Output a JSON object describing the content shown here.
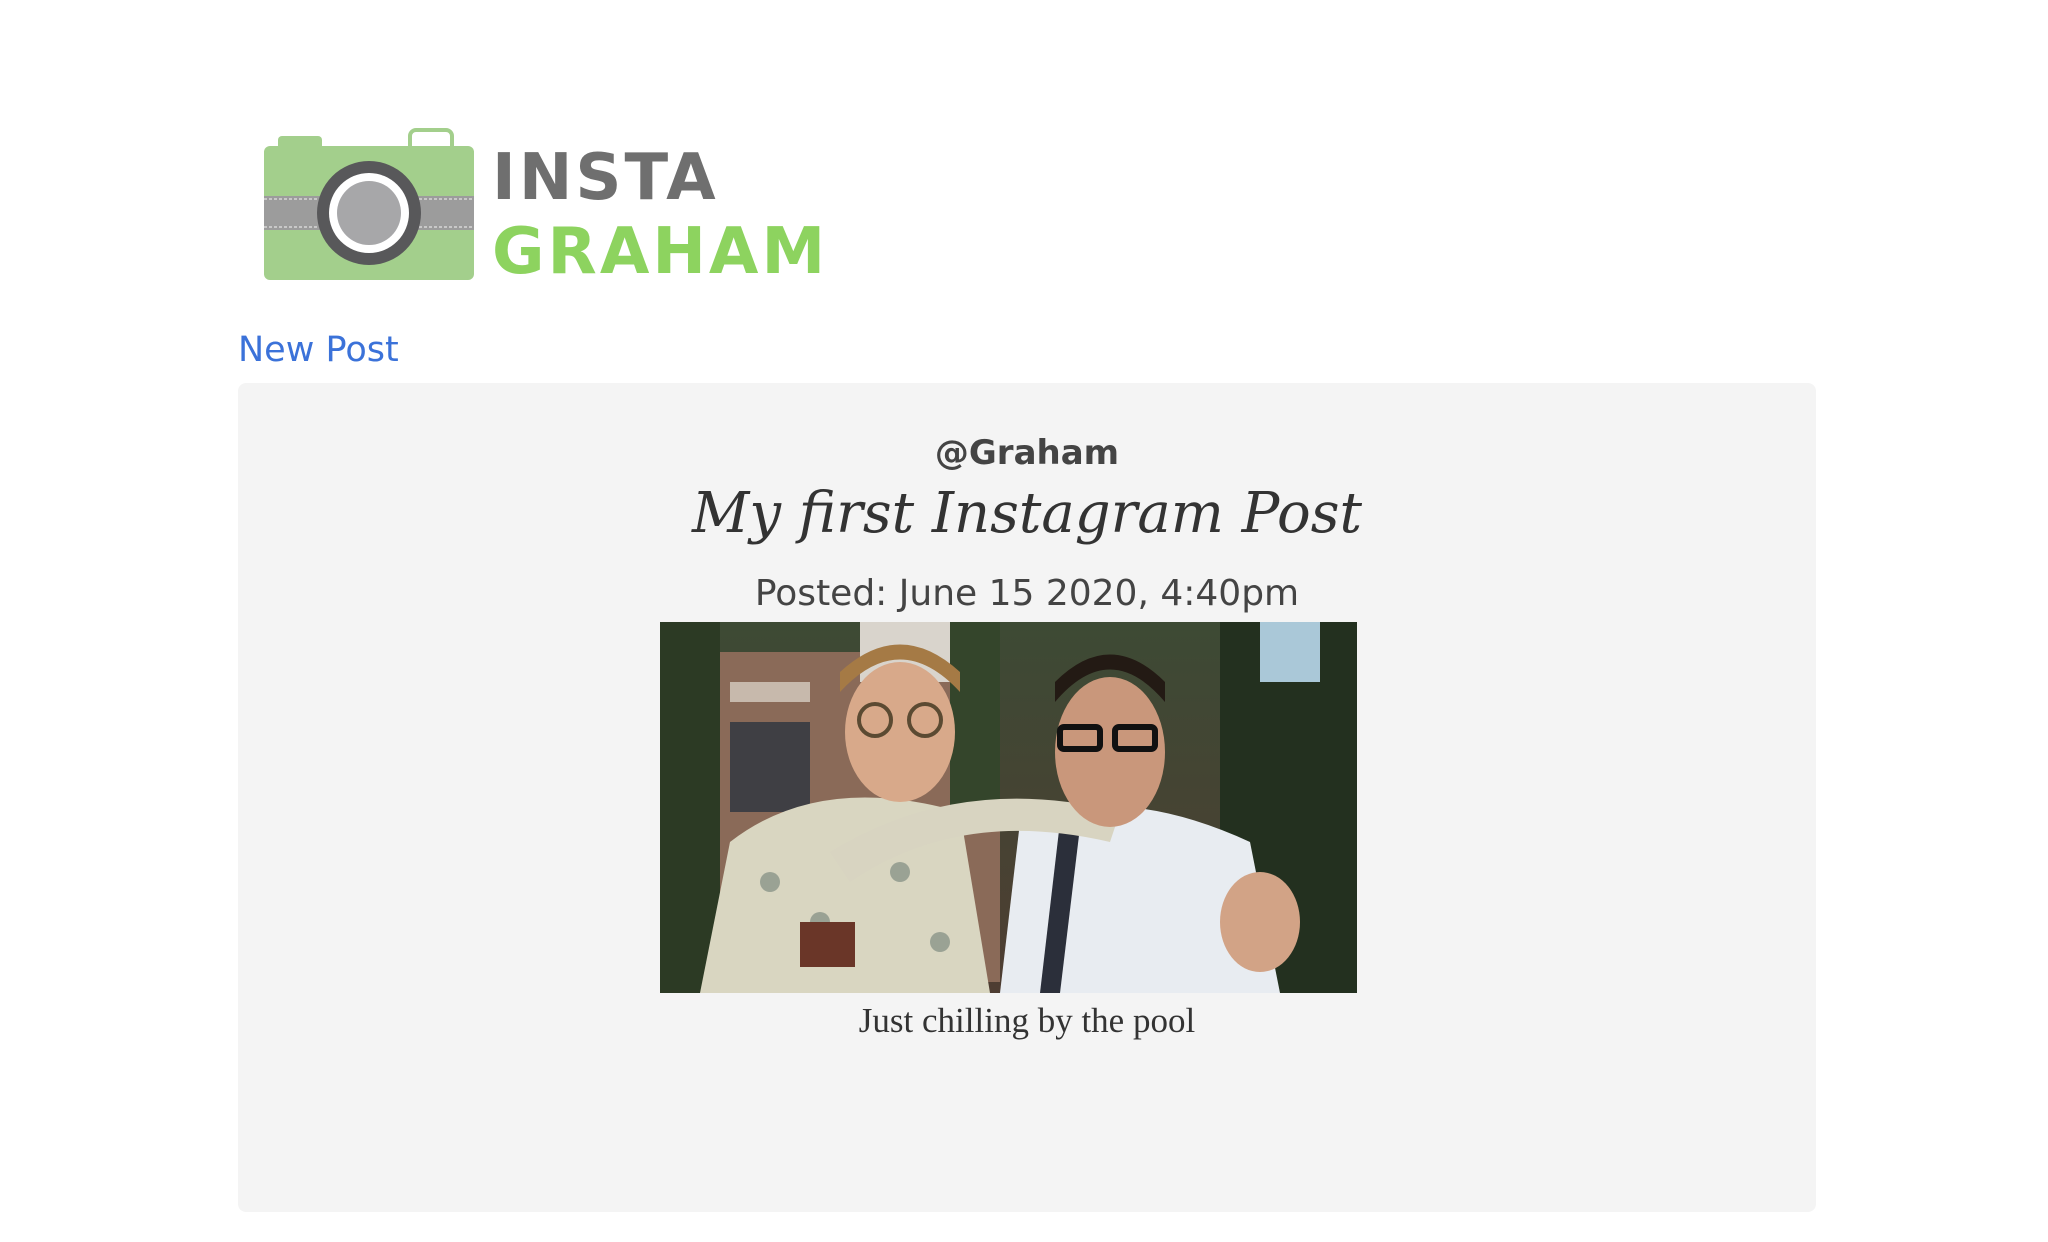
{
  "logo": {
    "word_top": "INSTA",
    "word_bottom": "GRAHAM",
    "icon": "camera-icon",
    "colors": {
      "camera_body": "#a3cf8c",
      "lens_ring": "#58585a",
      "lens_center": "#a7a7a9",
      "strap": "#9c9c9c",
      "word_top": "#6f6f6f",
      "word_bottom": "#8dd35f"
    }
  },
  "nav": {
    "new_post_label": "New Post",
    "link_color": "#3b72d9"
  },
  "post": {
    "username": "@Graham",
    "title": "My first Instagram Post",
    "date": "Posted: June 15 2020, 4:40pm",
    "caption": "Just chilling by the pool",
    "photo_alt": "post-photo"
  }
}
